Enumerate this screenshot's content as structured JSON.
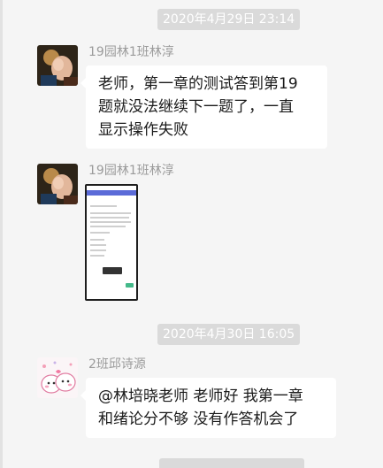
{
  "messages": [
    {
      "timestamp": "2020年4月29日 23:14",
      "sender": "19园林1班林淳",
      "text_lines": [
        "老师，第一章的测试答到第19",
        "题就没法继续下一题了，一直",
        "显示操作失败"
      ]
    },
    {
      "sender": "19园林1班林淳",
      "image": "phone-screenshot-image"
    },
    {
      "timestamp": "2020年4月30日 16:05",
      "sender": "2班邱诗源",
      "text_lines": [
        "@林培晓老师 老师好 我第一章",
        "和绪论分不够 没有作答机会了"
      ]
    }
  ]
}
